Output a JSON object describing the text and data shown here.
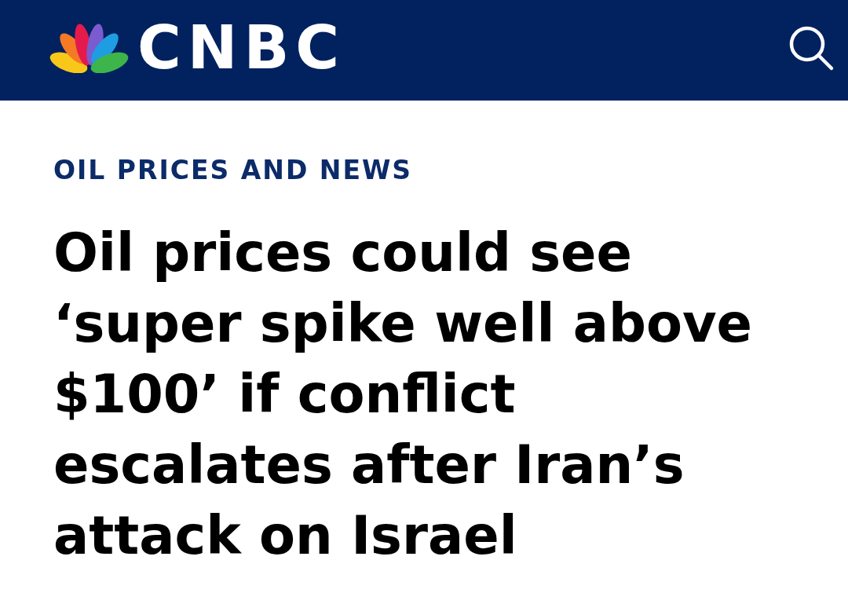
{
  "header": {
    "logo_text": "CNBC"
  },
  "article": {
    "section": "OIL PRICES AND NEWS",
    "headline_lines": [
      "Oil prices could see",
      "‘super spike well above",
      "$100’ if conflict",
      "escalates after Iran’s",
      "attack on Israel"
    ]
  }
}
